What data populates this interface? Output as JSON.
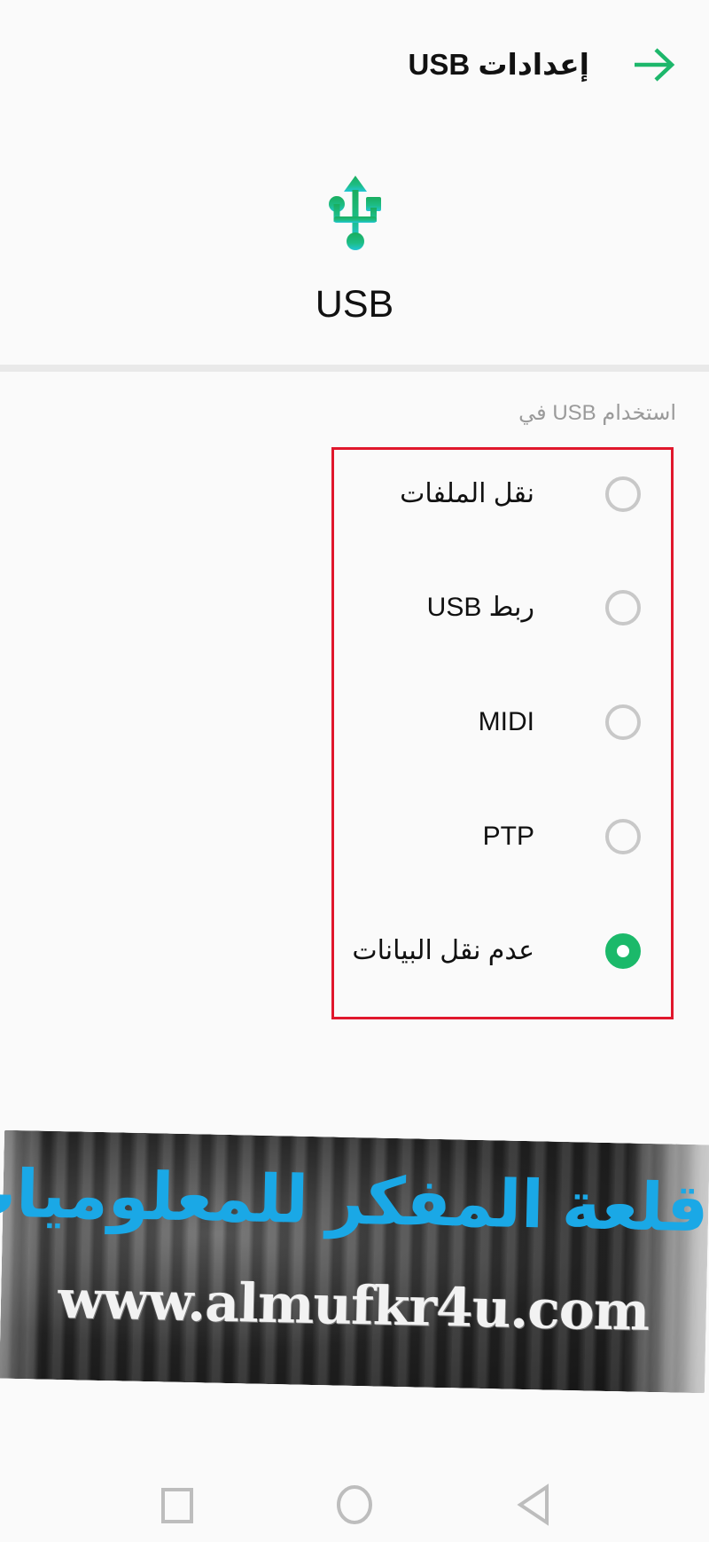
{
  "header": {
    "title": "إعدادات USB",
    "back_icon": "arrow-right-icon"
  },
  "hero": {
    "icon": "usb-icon",
    "label": "USB"
  },
  "section": {
    "label": "استخدام USB في"
  },
  "options": [
    {
      "label": "نقل الملفات",
      "selected": false
    },
    {
      "label": "ربط USB",
      "selected": false
    },
    {
      "label": "MIDI",
      "selected": false
    },
    {
      "label": "PTP",
      "selected": false
    },
    {
      "label": "عدم نقل البيانات",
      "selected": true
    }
  ],
  "watermark": {
    "title": "قلعة المفكر للمعلوميات",
    "url": "www.almufkr4u.com"
  },
  "nav_bar": {
    "recents_icon": "square-icon",
    "home_icon": "circle-icon",
    "back_icon": "triangle-back-icon"
  },
  "colors": {
    "accent": "#1bb96a",
    "highlight_border": "#e0172c",
    "radio_unchecked": "#c8c8c8",
    "watermark_title": "#1aa8e6"
  }
}
